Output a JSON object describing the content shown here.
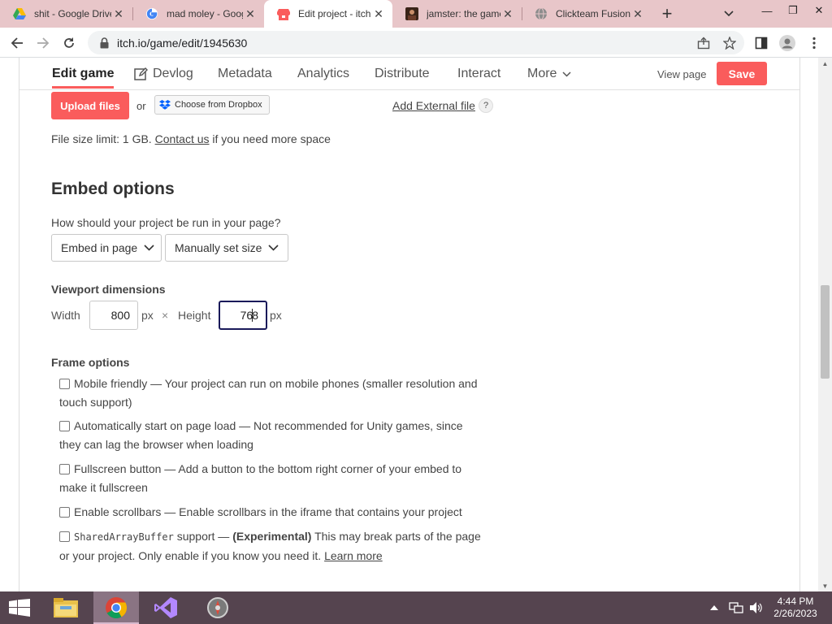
{
  "browser": {
    "tabs": [
      {
        "title": "shit - Google Drive",
        "icon": "google-drive-icon"
      },
      {
        "title": "mad moley - Google Search",
        "icon": "google-icon"
      },
      {
        "title": "Edit project - itch.io",
        "icon": "itchio-icon",
        "active": true
      },
      {
        "title": "jamster: the game",
        "icon": "avatar-icon"
      },
      {
        "title": "Clickteam Fusion",
        "icon": "globe-icon"
      }
    ],
    "url": "itch.io/game/edit/1945630",
    "window_controls": [
      "minimize",
      "restore",
      "close"
    ]
  },
  "nav": {
    "tabs": [
      {
        "label": "Edit game",
        "active": true
      },
      {
        "label": "Devlog"
      },
      {
        "label": "Metadata"
      },
      {
        "label": "Analytics"
      },
      {
        "label": "Distribute"
      },
      {
        "label": "Interact"
      },
      {
        "label": "More"
      }
    ],
    "view_page": "View page",
    "save": "Save"
  },
  "uploads": {
    "upload_button": "Upload files",
    "or": "or",
    "dropbox": "Choose from Dropbox",
    "add_external": "Add External file",
    "help": "?",
    "size_limit_prefix": "File size limit: 1 GB.",
    "contact_link": "Contact us",
    "size_limit_suffix": "if you need more space"
  },
  "embed": {
    "title": "Embed options",
    "question": "How should your project be run in your page?",
    "mode_select": "Embed in page",
    "size_select": "Manually set size",
    "viewport_label": "Viewport dimensions",
    "width_label": "Width",
    "width_value": "800",
    "px1": "px",
    "times": "×",
    "height_label": "Height",
    "height_value_before_caret": "76",
    "height_value_after_caret": "8",
    "px2": "px",
    "frame_title": "Frame options",
    "options": [
      {
        "label": "Mobile friendly",
        "desc": " — Your project can run on mobile phones (smaller resolution and touch support)",
        "checked": false
      },
      {
        "label": "Automatically start on page load",
        "desc": " — Not recommended for Unity games, since they can lag the browser when loading",
        "checked": false
      },
      {
        "label": "Fullscreen button",
        "desc": " — Add a button to the bottom right corner of your embed to make it fullscreen",
        "checked": false
      },
      {
        "label": "Enable scrollbars",
        "desc": " — Enable scrollbars in the iframe that contains your project",
        "checked": false
      }
    ],
    "sab": {
      "code": "SharedArrayBuffer",
      "label": " support — ",
      "experimental": "(Experimental)",
      "desc": " This may break parts of the page or your project. Only enable if you know you need it. ",
      "link": "Learn more",
      "checked": false
    }
  },
  "taskbar": {
    "apps": [
      "file-explorer-icon",
      "chrome-icon",
      "visual-studio-icon",
      "clickteam-fusion-icon"
    ],
    "time": "4:44 PM",
    "date": "2/26/2023"
  },
  "colors": {
    "accent": "#fa5c5c",
    "tabstrip": "#e8c6c9",
    "taskbar": "#55444f"
  }
}
